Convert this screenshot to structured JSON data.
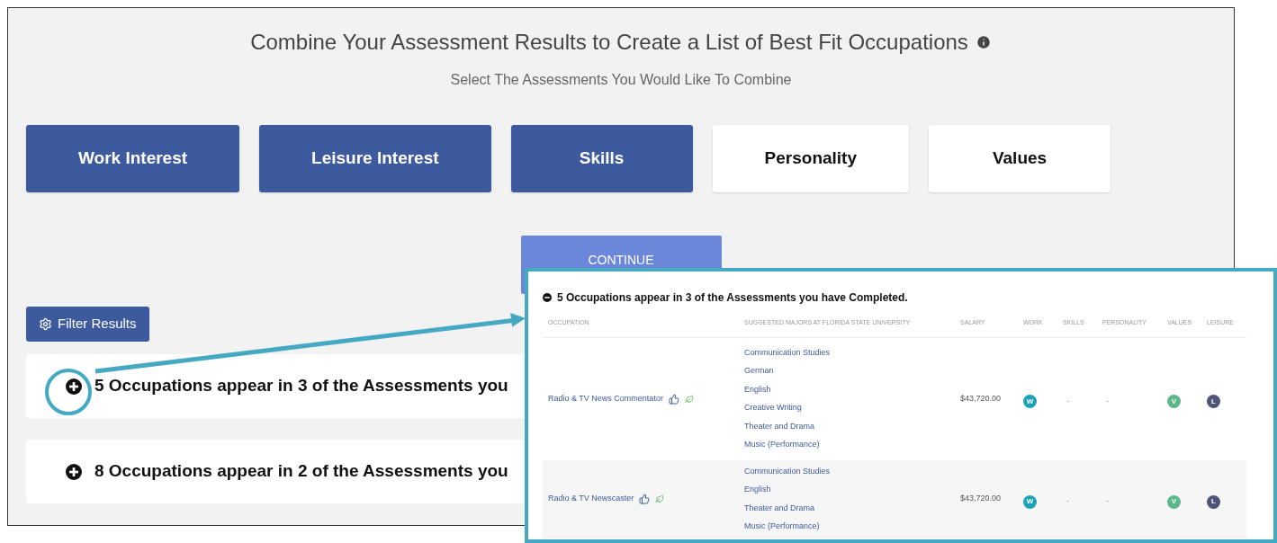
{
  "header": {
    "title": "Combine Your Assessment Results to Create a List of Best Fit Occupations",
    "subtitle": "Select The Assessments You Would Like To Combine"
  },
  "assessments": [
    {
      "label": "Work Interest",
      "selected": true
    },
    {
      "label": "Leisure Interest",
      "selected": true
    },
    {
      "label": "Skills",
      "selected": true
    },
    {
      "label": "Personality",
      "selected": false
    },
    {
      "label": "Values",
      "selected": false
    }
  ],
  "continue_button": "CONTINUE",
  "filter_button": "Filter Results",
  "groups": [
    {
      "text": "5 Occupations appear in 3 of the Assessments you",
      "expanded": false
    },
    {
      "text": "8 Occupations appear in 2 of the Assessments you",
      "expanded": false
    }
  ],
  "inset": {
    "title": "5 Occupations appear in 3 of the Assessments you have Completed.",
    "expanded": true,
    "columns": [
      "OCCUPATION",
      "SUGGESTED MAJORS AT FLORIDA STATE UNIVERSITY",
      "SALARY",
      "WORK",
      "SKILLS",
      "PERSONALITY",
      "VALUES",
      "LEISURE"
    ],
    "rows": [
      {
        "occupation": "Radio & TV News Commentator",
        "majors": [
          "Communication Studies",
          "German",
          "English",
          "Creative Writing",
          "Theater and Drama",
          "Music (Performance)"
        ],
        "salary": "$43,720.00",
        "work": {
          "kind": "badge",
          "text": "W",
          "color": "#1ba3b8"
        },
        "skills": {
          "kind": "dash",
          "text": "-"
        },
        "personality": {
          "kind": "dash",
          "text": "-"
        },
        "values": {
          "kind": "badge",
          "text": "V",
          "color": "#5cb88a"
        },
        "leisure": {
          "kind": "badge",
          "text": "L",
          "color": "#4d5478"
        }
      },
      {
        "occupation": "Radio & TV Newscaster",
        "majors": [
          "Communication Studies",
          "English",
          "Theater and Drama",
          "Music (Performance)"
        ],
        "salary": "$43,720.00",
        "work": {
          "kind": "badge",
          "text": "W",
          "color": "#1ba3b8"
        },
        "skills": {
          "kind": "dash",
          "text": "-"
        },
        "personality": {
          "kind": "dash",
          "text": "-"
        },
        "values": {
          "kind": "badge",
          "text": "V",
          "color": "#5cb88a"
        },
        "leisure": {
          "kind": "badge",
          "text": "L",
          "color": "#4d5478"
        }
      }
    ]
  }
}
